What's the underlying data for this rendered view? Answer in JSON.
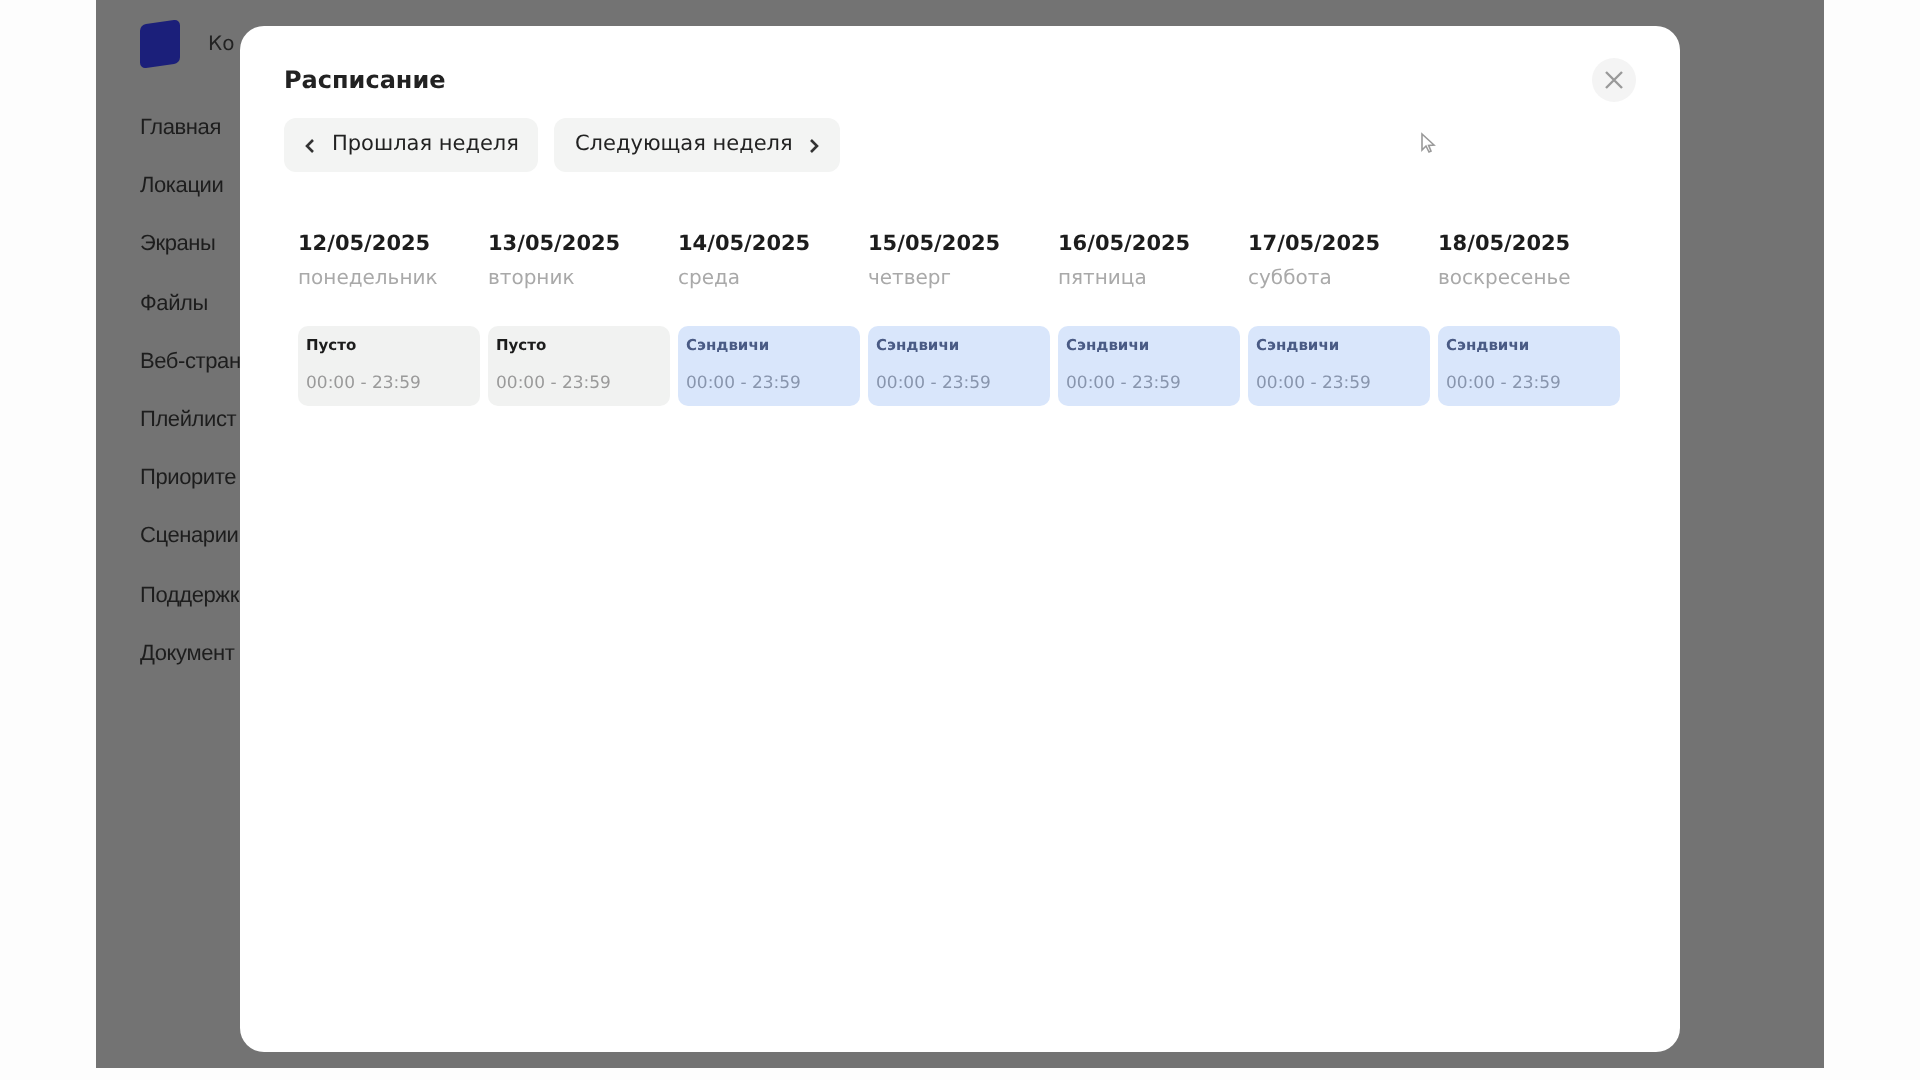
{
  "sidebar": {
    "logo_text": "Ко",
    "items": [
      "Главная",
      "Локации",
      "Экраны",
      "Файлы",
      "Веб-стран",
      "Плейлист",
      "Приорите",
      "Сценарии",
      "Поддержк",
      "Документ"
    ]
  },
  "modal": {
    "title": "Расписание",
    "prev_button": "Прошлая неделя",
    "next_button": "Следующая неделя",
    "days": [
      {
        "date": "12/05/2025",
        "weekday": "понедельник",
        "entry": {
          "kind": "empty",
          "title": "Пусто",
          "time": "00:00 - 23:59"
        }
      },
      {
        "date": "13/05/2025",
        "weekday": "вторник",
        "entry": {
          "kind": "empty",
          "title": "Пусто",
          "time": "00:00 - 23:59"
        }
      },
      {
        "date": "14/05/2025",
        "weekday": "среда",
        "entry": {
          "kind": "playlist",
          "title": "Сэндвичи",
          "time": "00:00 - 23:59"
        }
      },
      {
        "date": "15/05/2025",
        "weekday": "четверг",
        "entry": {
          "kind": "playlist",
          "title": "Сэндвичи",
          "time": "00:00 - 23:59"
        }
      },
      {
        "date": "16/05/2025",
        "weekday": "пятница",
        "entry": {
          "kind": "playlist",
          "title": "Сэндвичи",
          "time": "00:00 - 23:59"
        }
      },
      {
        "date": "17/05/2025",
        "weekday": "суббота",
        "entry": {
          "kind": "playlist",
          "title": "Сэндвичи",
          "time": "00:00 - 23:59"
        }
      },
      {
        "date": "18/05/2025",
        "weekday": "воскресенье",
        "entry": {
          "kind": "playlist",
          "title": "Сэндвичи",
          "time": "00:00 - 23:59"
        }
      }
    ]
  }
}
